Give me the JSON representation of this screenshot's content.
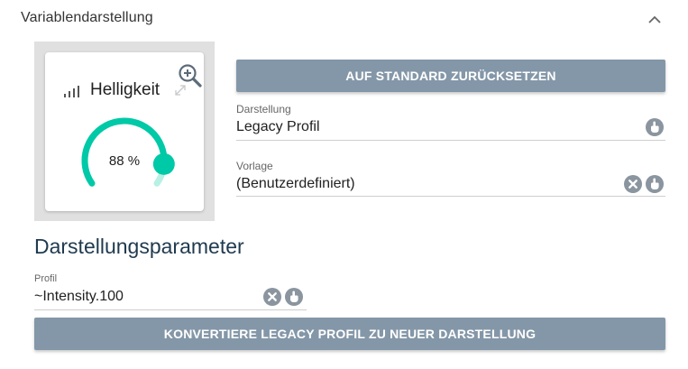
{
  "section": {
    "title": "Variablendarstellung"
  },
  "preview": {
    "tile_title": "Helligkeit",
    "gauge_value": "88 %",
    "gauge_fraction": 0.88
  },
  "actions": {
    "reset_label": "AUF STANDARD ZURÜCKSETZEN",
    "convert_label": "KONVERTIERE LEGACY PROFIL ZU NEUER DARSTELLUNG"
  },
  "fields": {
    "darstellung": {
      "label": "Darstellung",
      "value": "Legacy Profil"
    },
    "vorlage": {
      "label": "Vorlage",
      "value": "(Benutzerdefiniert)"
    },
    "profil": {
      "label": "Profil",
      "value": "~Intensity.100"
    }
  },
  "parameters": {
    "heading": "Darstellungsparameter"
  },
  "colors": {
    "gauge_accent": "#00c9a7",
    "button_bg": "#8497a8",
    "icon_gray": "#8a959f",
    "heading": "#1f3a4f"
  },
  "icons": {
    "collapse": "chevron-up-icon",
    "signal": "signal-strength-icon",
    "zoom": "zoom-in-icon",
    "expand": "expand-icon",
    "select": "pointer-hand-icon",
    "clear": "clear-icon"
  }
}
